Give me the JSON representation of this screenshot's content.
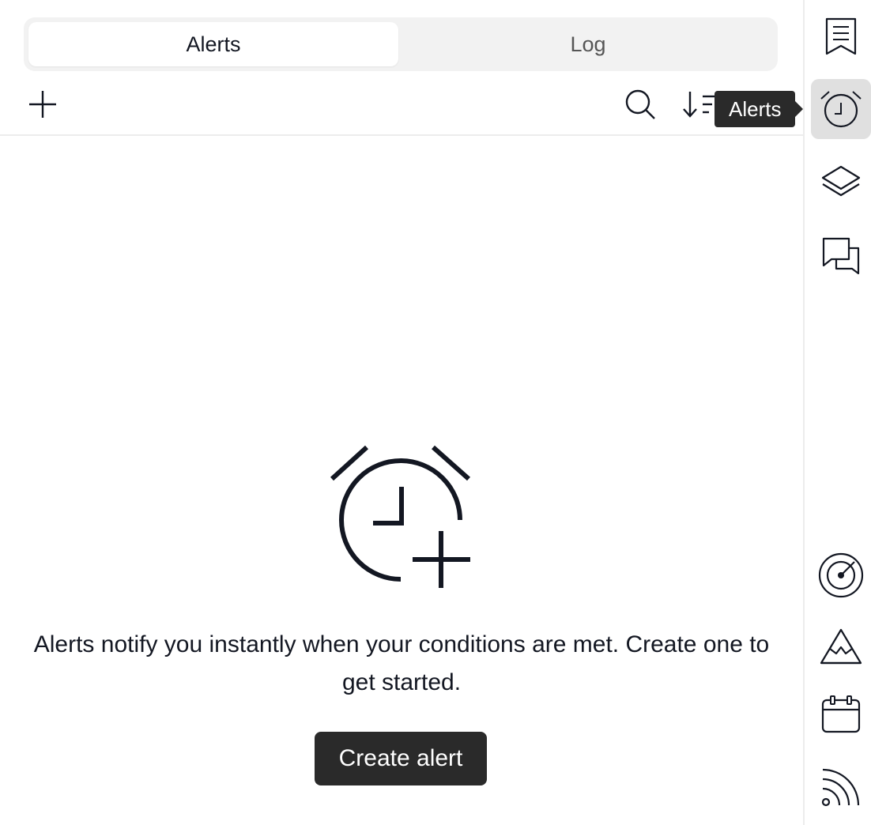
{
  "tabs": [
    {
      "label": "Alerts",
      "active": true
    },
    {
      "label": "Log",
      "active": false
    }
  ],
  "toolbar": {
    "add_icon": "plus-icon",
    "search_icon": "search-icon",
    "sort_icon": "sort-icon"
  },
  "tooltip": {
    "text": "Alerts"
  },
  "empty_state": {
    "icon": "alarm-clock-plus-icon",
    "message": "Alerts notify you instantly when your conditions are met. Create one to get started.",
    "button_label": "Create alert"
  },
  "sidebar": {
    "items": [
      {
        "icon": "watchlist-icon",
        "active": false
      },
      {
        "icon": "alarm-clock-icon",
        "active": true
      },
      {
        "icon": "layers-icon",
        "active": false
      },
      {
        "icon": "chat-icon",
        "active": false
      },
      {
        "icon": "radar-icon",
        "active": false
      },
      {
        "icon": "mountains-icon",
        "active": false
      },
      {
        "icon": "calendar-icon",
        "active": false
      },
      {
        "icon": "feed-icon",
        "active": false
      }
    ]
  },
  "colors": {
    "text": "#131722",
    "button_bg": "#2a2a2a",
    "active_bg": "#e0e0e0",
    "segment_bg": "#f2f2f2"
  }
}
